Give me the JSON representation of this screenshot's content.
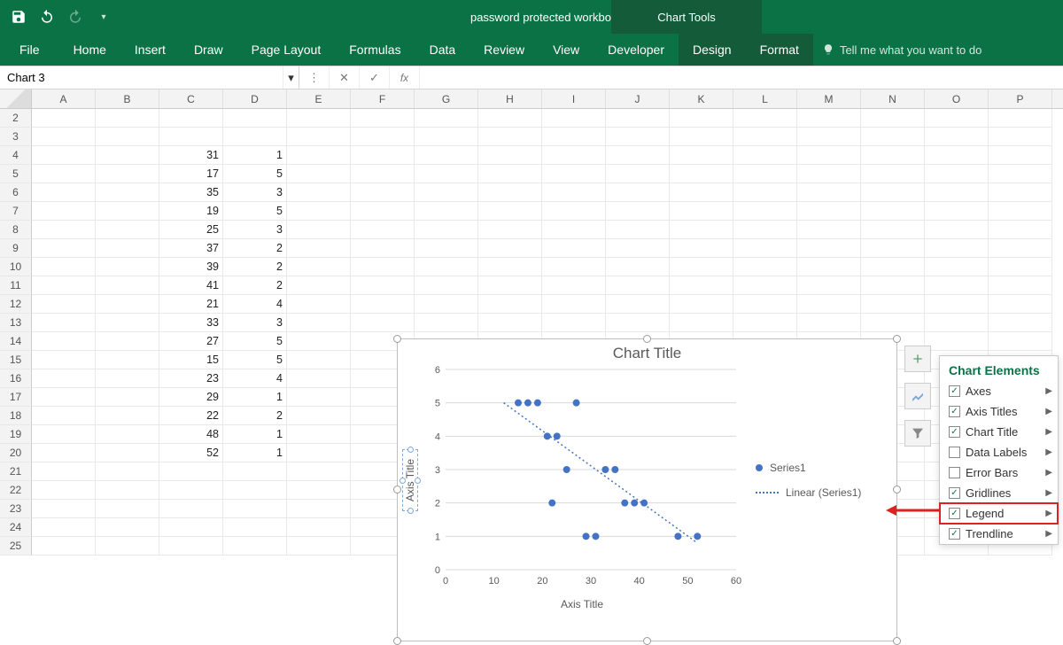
{
  "app": {
    "title": "password protected workbook  -  Excel",
    "chart_tools_label": "Chart Tools"
  },
  "qat": {
    "save": "Save",
    "undo": "Undo",
    "redo": "Redo"
  },
  "tabs": {
    "file": "File",
    "home": "Home",
    "insert": "Insert",
    "draw": "Draw",
    "page_layout": "Page Layout",
    "formulas": "Formulas",
    "data": "Data",
    "review": "Review",
    "view": "View",
    "developer": "Developer",
    "design": "Design",
    "format": "Format",
    "tell_me": "Tell me what you want to do"
  },
  "namebar": {
    "name_value": "Chart 3",
    "fx_label": "fx"
  },
  "grid": {
    "columns": [
      "A",
      "B",
      "C",
      "D",
      "E",
      "F",
      "G",
      "H",
      "I",
      "J",
      "K",
      "L",
      "M",
      "N",
      "O",
      "P"
    ],
    "row_start": 2,
    "row_end": 25,
    "data": {
      "C": {
        "4": 31,
        "5": 17,
        "6": 35,
        "7": 19,
        "8": 25,
        "9": 37,
        "10": 39,
        "11": 41,
        "12": 21,
        "13": 33,
        "14": 27,
        "15": 15,
        "16": 23,
        "17": 29,
        "18": 22,
        "19": 48,
        "20": 52
      },
      "D": {
        "4": 1,
        "5": 5,
        "6": 3,
        "7": 5,
        "8": 3,
        "9": 2,
        "10": 2,
        "11": 2,
        "12": 4,
        "13": 3,
        "14": 5,
        "15": 5,
        "16": 4,
        "17": 1,
        "18": 2,
        "19": 1,
        "20": 1
      }
    }
  },
  "chart": {
    "title": "Chart Title",
    "y_axis_title": "Axis Title",
    "x_axis_title": "Axis Title",
    "legend": {
      "s1": "Series1",
      "s2": "Linear (Series1)"
    }
  },
  "chart_data": {
    "type": "scatter",
    "title": "Chart Title",
    "xlabel": "Axis Title",
    "ylabel": "Axis Title",
    "xlim": [
      0,
      60
    ],
    "ylim": [
      0,
      6
    ],
    "x_ticks": [
      0,
      10,
      20,
      30,
      40,
      50,
      60
    ],
    "y_ticks": [
      0,
      1,
      2,
      3,
      4,
      5,
      6
    ],
    "series": [
      {
        "name": "Series1",
        "type": "scatter",
        "points": [
          {
            "x": 15,
            "y": 5
          },
          {
            "x": 17,
            "y": 5
          },
          {
            "x": 19,
            "y": 5
          },
          {
            "x": 27,
            "y": 5
          },
          {
            "x": 21,
            "y": 4
          },
          {
            "x": 23,
            "y": 4
          },
          {
            "x": 25,
            "y": 3
          },
          {
            "x": 33,
            "y": 3
          },
          {
            "x": 35,
            "y": 3
          },
          {
            "x": 22,
            "y": 2
          },
          {
            "x": 37,
            "y": 2
          },
          {
            "x": 39,
            "y": 2
          },
          {
            "x": 41,
            "y": 2
          },
          {
            "x": 29,
            "y": 1
          },
          {
            "x": 31,
            "y": 1
          },
          {
            "x": 48,
            "y": 1
          },
          {
            "x": 52,
            "y": 1
          }
        ]
      },
      {
        "name": "Linear (Series1)",
        "type": "trendline",
        "p1": {
          "x": 12,
          "y": 5
        },
        "p2": {
          "x": 52,
          "y": 0.8
        }
      }
    ]
  },
  "flyout": {
    "title": "Chart Elements",
    "items": [
      {
        "label": "Axes",
        "checked": true
      },
      {
        "label": "Axis Titles",
        "checked": true
      },
      {
        "label": "Chart Title",
        "checked": true
      },
      {
        "label": "Data Labels",
        "checked": false
      },
      {
        "label": "Error Bars",
        "checked": false
      },
      {
        "label": "Gridlines",
        "checked": true
      },
      {
        "label": "Legend",
        "checked": true,
        "highlight": true
      },
      {
        "label": "Trendline",
        "checked": true
      }
    ]
  }
}
